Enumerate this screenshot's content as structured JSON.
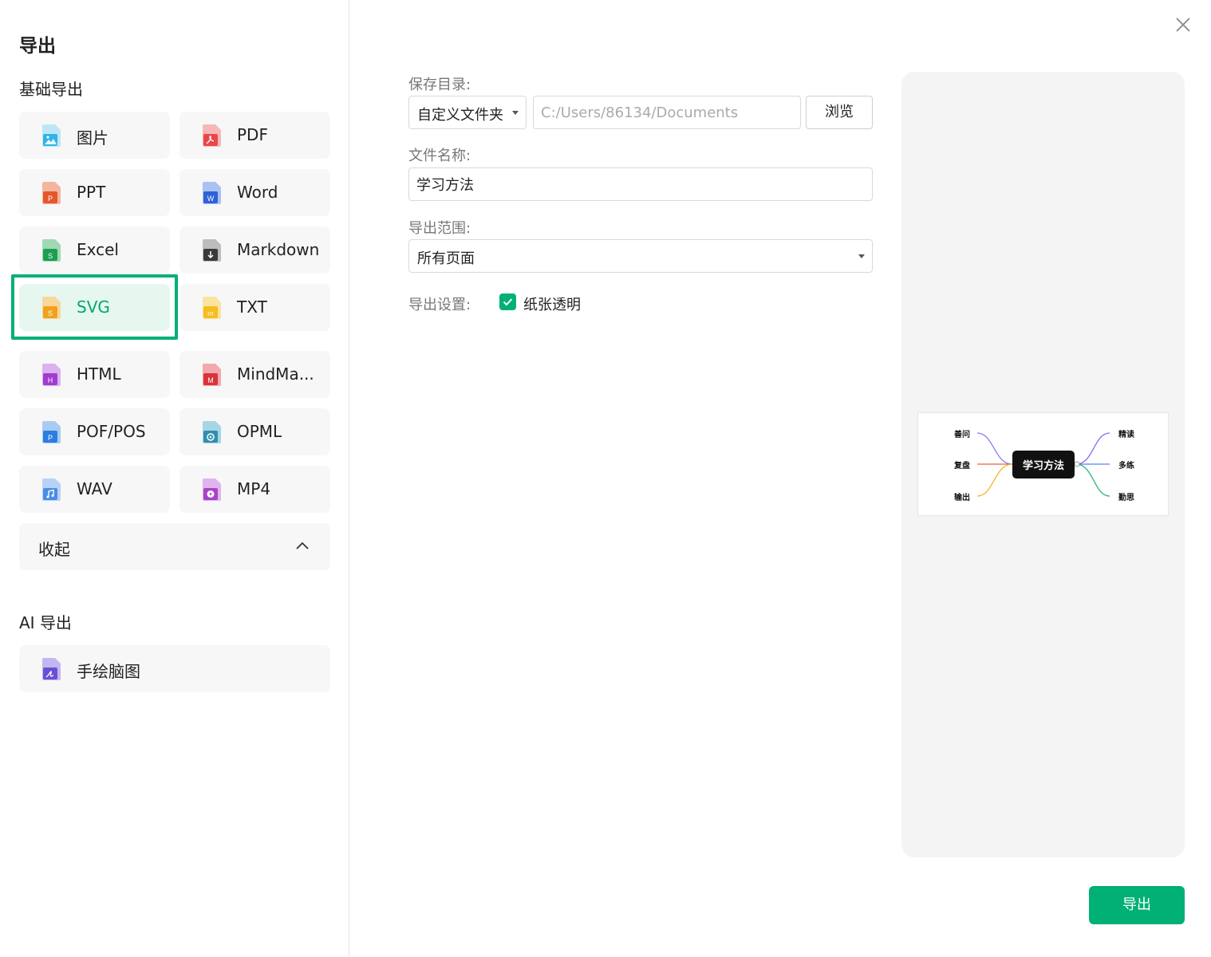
{
  "dialog": {
    "title": "导出"
  },
  "sidebar": {
    "basic_title": "基础导出",
    "formats": [
      {
        "label": "图片",
        "icon": "image-file-icon",
        "color": "#2fb3e8"
      },
      {
        "label": "PDF",
        "icon": "pdf-file-icon",
        "color": "#e8474a"
      },
      {
        "label": "PPT",
        "icon": "ppt-file-icon",
        "color": "#e4572e"
      },
      {
        "label": "Word",
        "icon": "word-file-icon",
        "color": "#2f62d8"
      },
      {
        "label": "Excel",
        "icon": "excel-file-icon",
        "color": "#1e9e52"
      },
      {
        "label": "Markdown",
        "icon": "markdown-file-icon",
        "color": "#3a3a3a"
      },
      {
        "label": "SVG",
        "icon": "svg-file-icon",
        "color": "#f0a21c"
      },
      {
        "label": "TXT",
        "icon": "txt-file-icon",
        "color": "#f5bd1f"
      },
      {
        "label": "HTML",
        "icon": "html-file-icon",
        "color": "#a23bd1"
      },
      {
        "label": "MindMa...",
        "icon": "mindmanager-file-icon",
        "color": "#d9343b"
      },
      {
        "label": "POF/POS",
        "icon": "pof-file-icon",
        "color": "#2d7de0"
      },
      {
        "label": "OPML",
        "icon": "opml-file-icon",
        "color": "#2f8fb0"
      },
      {
        "label": "WAV",
        "icon": "wav-file-icon",
        "color": "#4b8de6"
      },
      {
        "label": "MP4",
        "icon": "mp4-file-icon",
        "color": "#a843c9"
      }
    ],
    "selected": "SVG",
    "collapse_label": "收起",
    "ai_title": "AI 导出",
    "ai_formats": [
      {
        "label": "手绘脑图",
        "icon": "handdrawn-mindmap-icon",
        "color": "#6a4fd6"
      }
    ]
  },
  "form": {
    "save_dir_label": "保存目录:",
    "folder_select": "自定义文件夹",
    "path_value": "C:/Users/86134/Documents",
    "browse_label": "浏览",
    "filename_label": "文件名称:",
    "filename_value": "学习方法",
    "range_label": "导出范围:",
    "range_value": "所有页面",
    "settings_label": "导出设置:",
    "transparent_label": "纸张透明",
    "transparent_checked": true
  },
  "preview": {
    "center": "学习方法",
    "left": [
      "善问",
      "复盘",
      "输出"
    ],
    "right": [
      "精读",
      "多练",
      "勤思"
    ]
  },
  "actions": {
    "export_label": "导出"
  },
  "colors": {
    "accent": "#00b074",
    "panel": "#f4f4f4"
  }
}
